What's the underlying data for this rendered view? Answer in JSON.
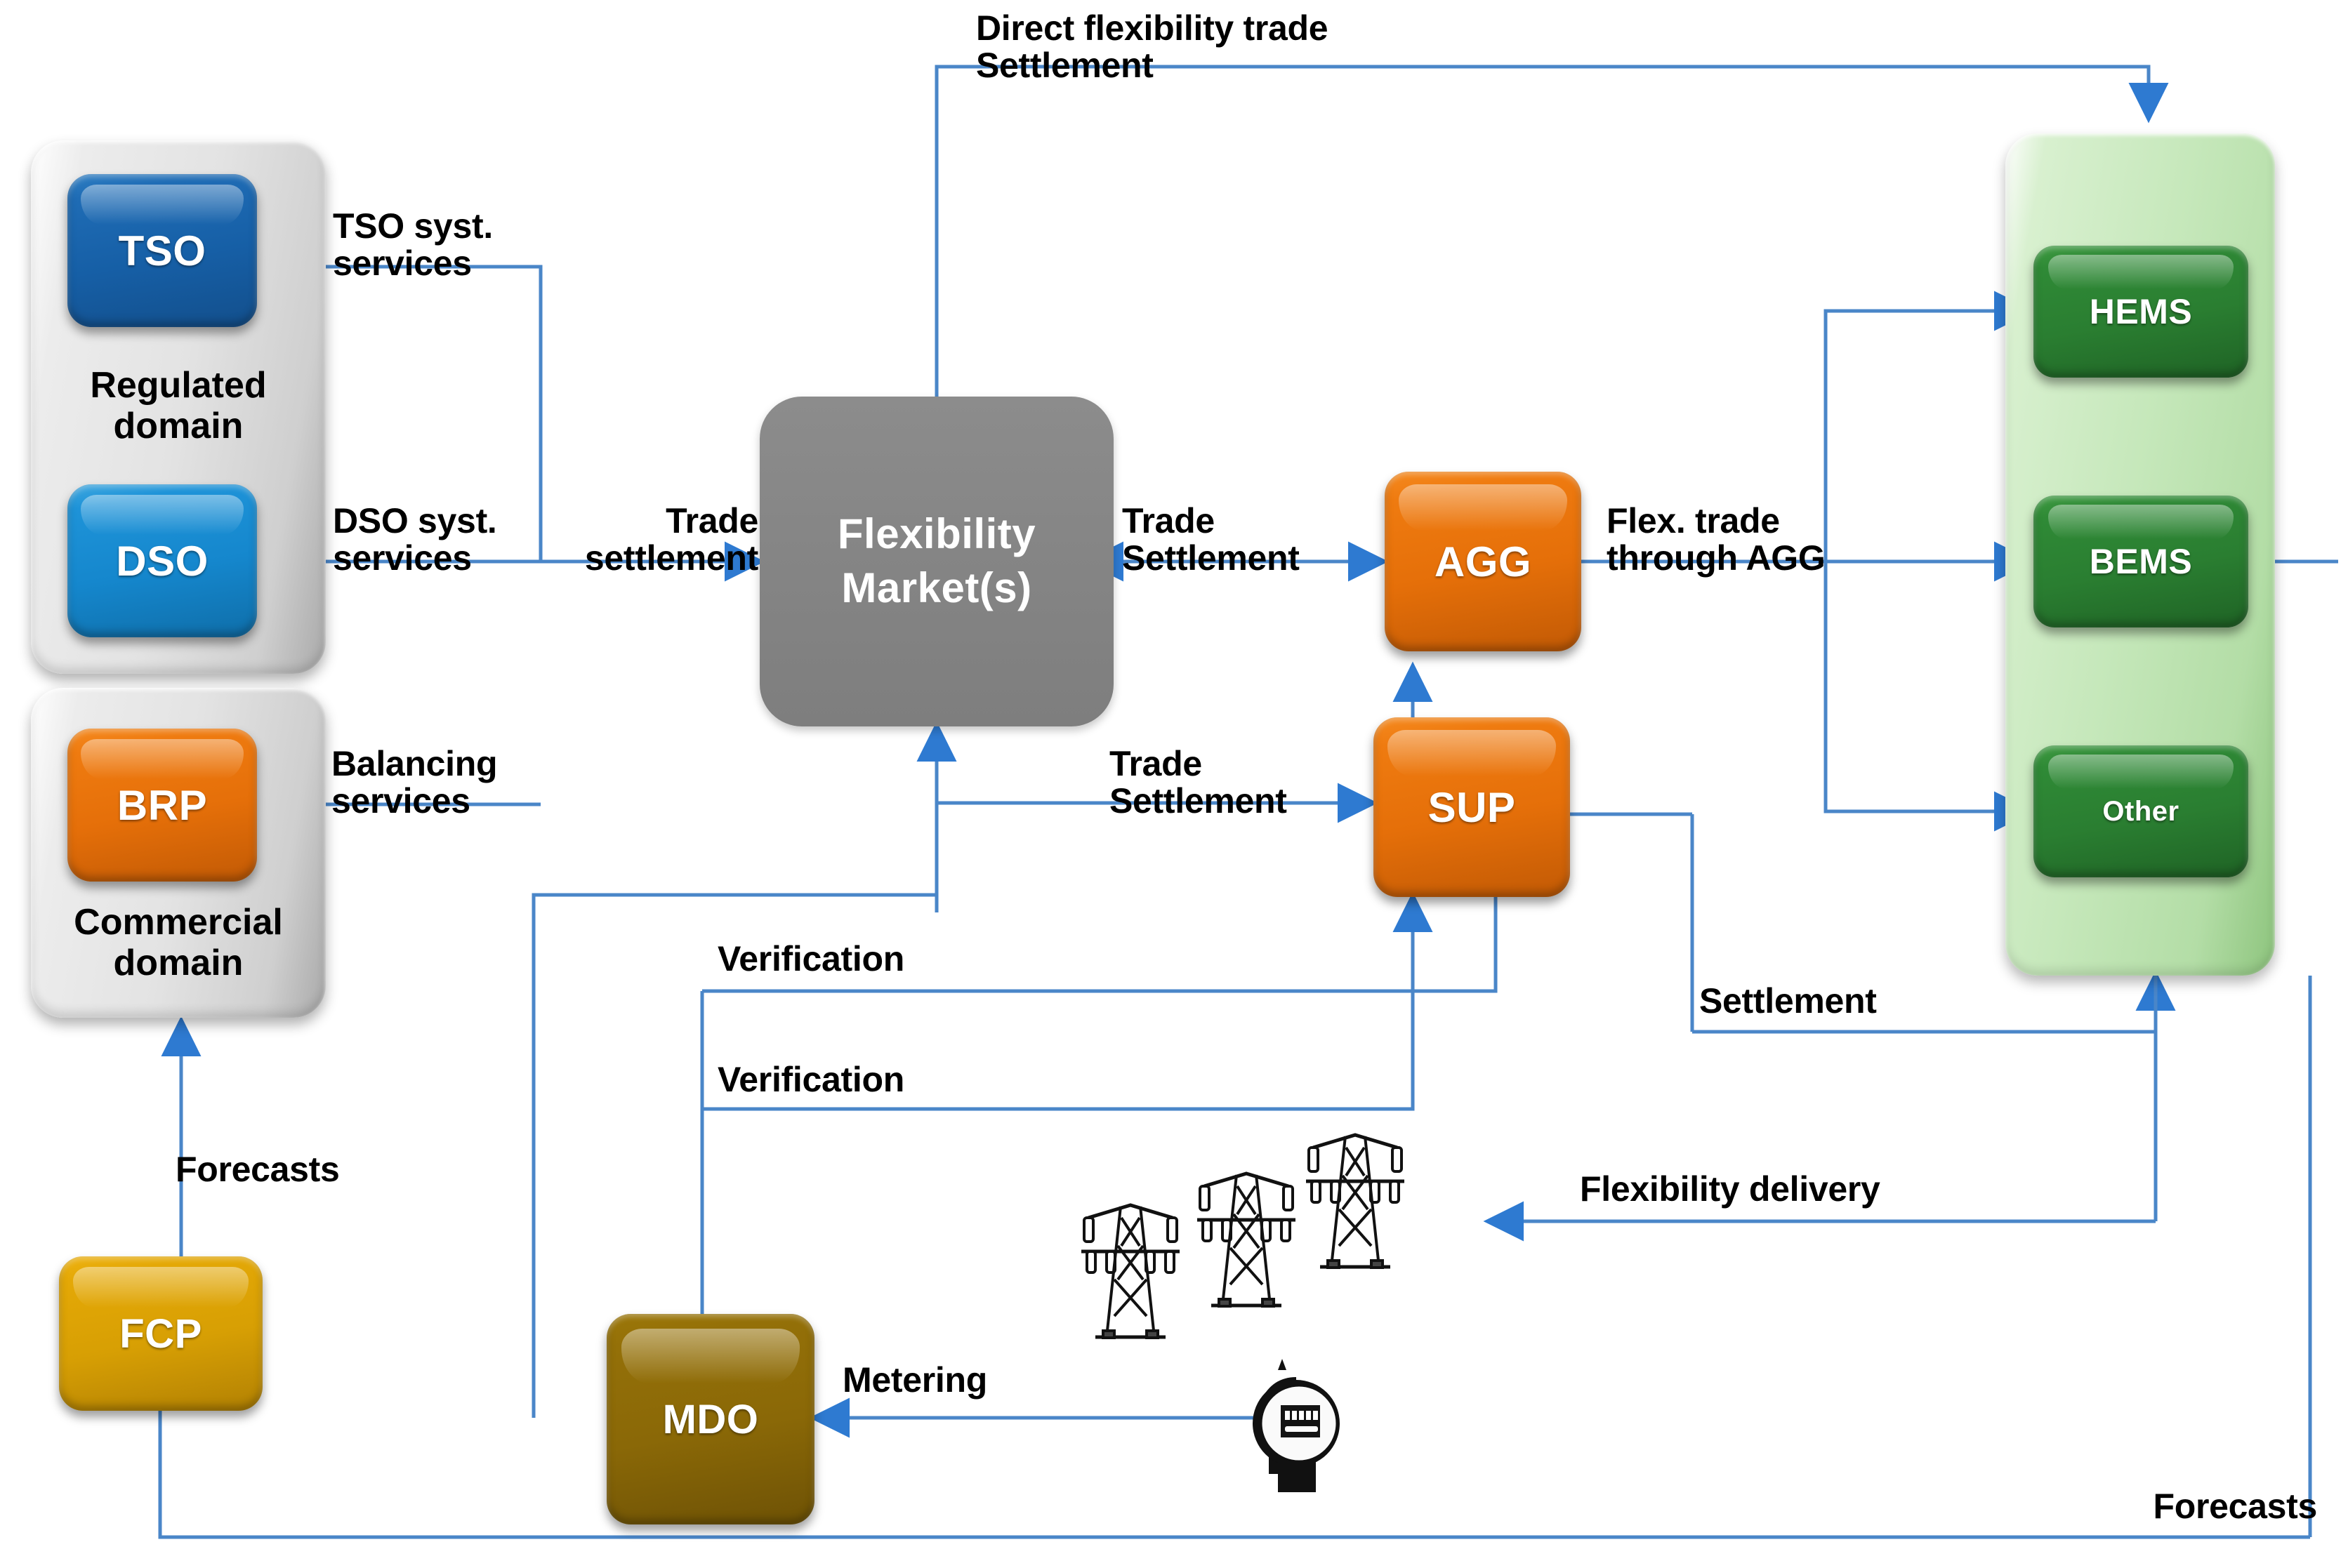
{
  "diagram": {
    "title": "Flexibility market actors and information flows",
    "colors": {
      "wire": "#4a86c8",
      "arrow": "#2e7ad1",
      "tso": "#1f6cb5",
      "dso": "#1e93d8",
      "brp": "#ef7b10",
      "agg": "#ef7b10",
      "sup": "#ef7b10",
      "fcp": "#e4a806",
      "mdo": "#947008",
      "market": "#868686",
      "ems": "#2f8a36",
      "group_grey": "#e3e3e3",
      "group_green": "#c6e8bb"
    }
  },
  "groups": {
    "regulated": {
      "caption": "Regulated\ndomain"
    },
    "commercial": {
      "caption": "Commercial\ndomain"
    },
    "customer": {
      "caption": ""
    }
  },
  "nodes": {
    "tso": {
      "label": "TSO"
    },
    "dso": {
      "label": "DSO"
    },
    "brp": {
      "label": "BRP"
    },
    "market": {
      "label": "Flexibility\nMarket(s)"
    },
    "agg": {
      "label": "AGG"
    },
    "sup": {
      "label": "SUP"
    },
    "fcp": {
      "label": "FCP"
    },
    "mdo": {
      "label": "MDO"
    },
    "hems": {
      "label": "HEMS"
    },
    "bems": {
      "label": "BEMS"
    },
    "other": {
      "label": "Other"
    }
  },
  "edge_labels": {
    "direct_trade": "Direct flexibility trade\nSettlement",
    "tso_services": "TSO syst.\nservices",
    "dso_services": "DSO syst.\nservices",
    "balancing": "Balancing\nservices",
    "trade_settlement_market": "Trade\nsettlement",
    "trade_settlement_agg": "Trade\nSettlement",
    "trade_settlement_sup": "Trade\nSettlement",
    "flex_trade_agg": "Flex. trade\nthrough AGG",
    "verification_1": "Verification",
    "verification_2": "Verification",
    "settlement_right": "Settlement",
    "flex_delivery": "Flexibility delivery",
    "metering": "Metering",
    "forecasts_left": "Forecasts",
    "forecasts_bottom": "Forecasts"
  },
  "artwork": {
    "pylons": "transmission-tower-icon",
    "meter": "electricity-meter-icon"
  }
}
